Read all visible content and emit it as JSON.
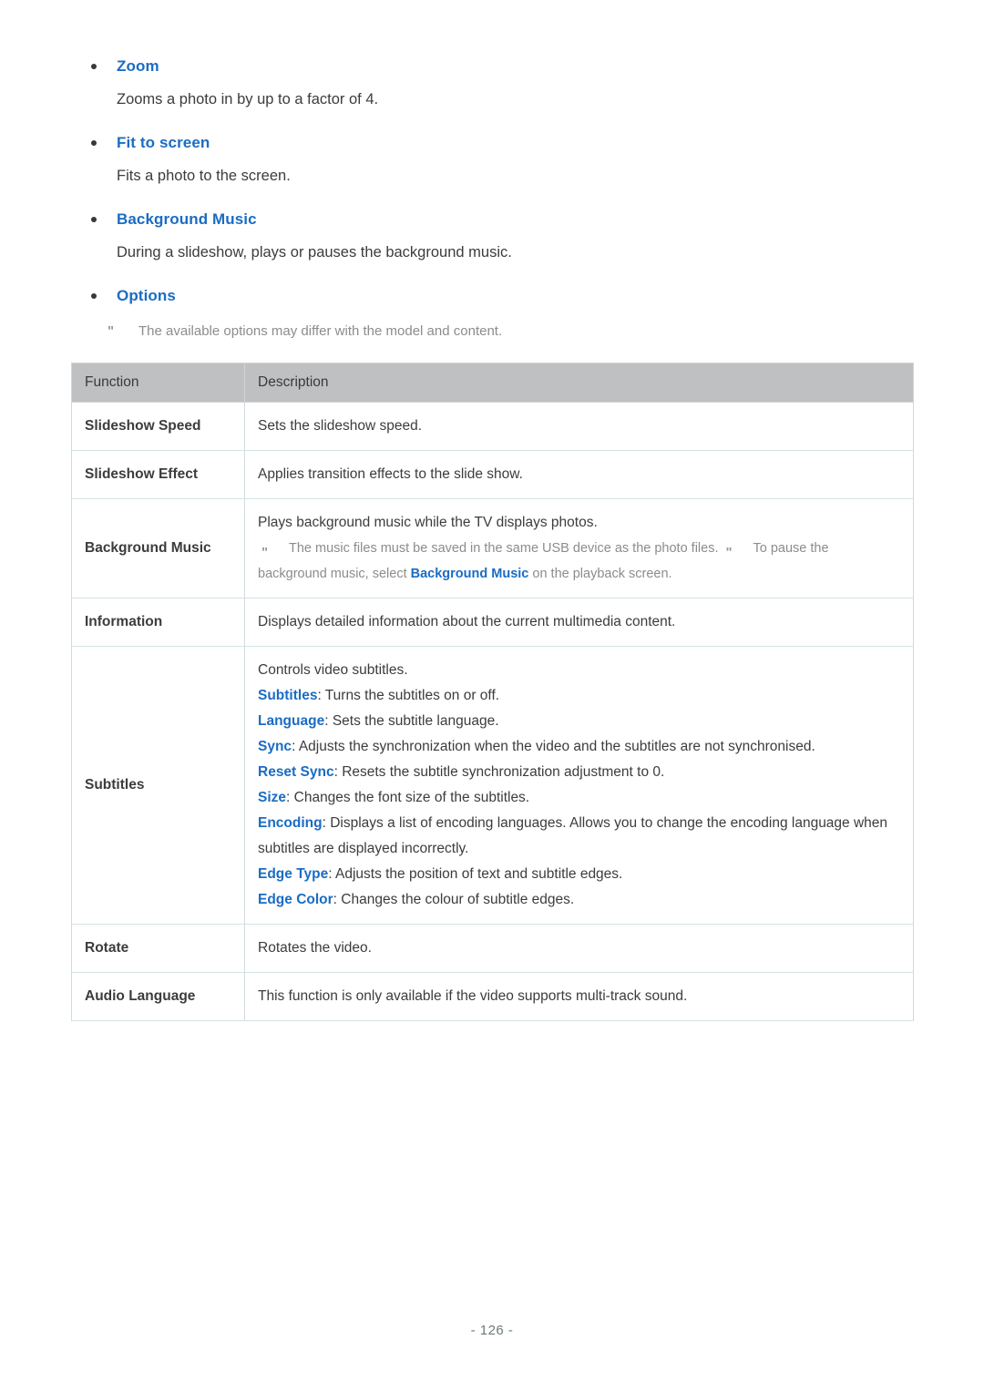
{
  "sections": [
    {
      "title": "Zoom",
      "body": "Zooms a photo in by up to a factor of 4."
    },
    {
      "title": "Fit to screen",
      "body": "Fits a photo to the screen."
    },
    {
      "title": "Background Music",
      "body": "During a slideshow, plays or pauses the background music."
    },
    {
      "title": "Options",
      "body": ""
    }
  ],
  "options_note": {
    "marker": "\"",
    "text": "The available options may differ with the model and content."
  },
  "table": {
    "headers": [
      "Function",
      "Description"
    ],
    "rows": [
      {
        "function": "Slideshow Speed",
        "description": "Sets the slideshow speed."
      },
      {
        "function": "Slideshow Effect",
        "description": "Applies transition effects to the slide show."
      },
      {
        "function": "Background Music",
        "intro": "Plays background music while the TV displays photos.",
        "notes": [
          {
            "marker": "\"",
            "pre": "The music files must be saved in the same USB device as the photo files.",
            "hl": "",
            "post": ""
          },
          {
            "marker": "\"",
            "pre": "To pause the background music, select ",
            "hl": "Background Music",
            "post": " on the playback screen."
          }
        ]
      },
      {
        "function": "Information",
        "description": "Displays detailed information about the current multimedia content."
      },
      {
        "function": "Subtitles",
        "intro": "Controls video subtitles.",
        "items": [
          {
            "term": "Subtitles",
            "text": ": Turns the subtitles on or off."
          },
          {
            "term": "Language",
            "text": ": Sets the subtitle language."
          },
          {
            "term": "Sync",
            "text": ": Adjusts the synchronization when the video and the subtitles are not synchronised."
          },
          {
            "term": "Reset Sync",
            "text": ": Resets the subtitle synchronization adjustment to 0."
          },
          {
            "term": "Size",
            "text": ": Changes the font size of the subtitles."
          },
          {
            "term": "Encoding",
            "text": ": Displays a list of encoding languages. Allows you to change the encoding language when subtitles are displayed incorrectly."
          },
          {
            "term": "Edge Type",
            "text": ": Adjusts the position of text and subtitle edges."
          },
          {
            "term": "Edge Color",
            "text": ": Changes the colour of subtitle edges."
          }
        ]
      },
      {
        "function": "Rotate",
        "description": "Rotates the video."
      },
      {
        "function": "Audio Language",
        "description": "This function is only available if the video supports multi-track sound."
      }
    ]
  },
  "footer": {
    "page_number": "- 126 -"
  },
  "colors": {
    "accent_blue": "#1a6cc4",
    "header_gray": "#bfc0c1",
    "note_gray": "#8c8c8c",
    "footer_gray": "#6d7b77",
    "row_border": "#d3e2e4"
  }
}
